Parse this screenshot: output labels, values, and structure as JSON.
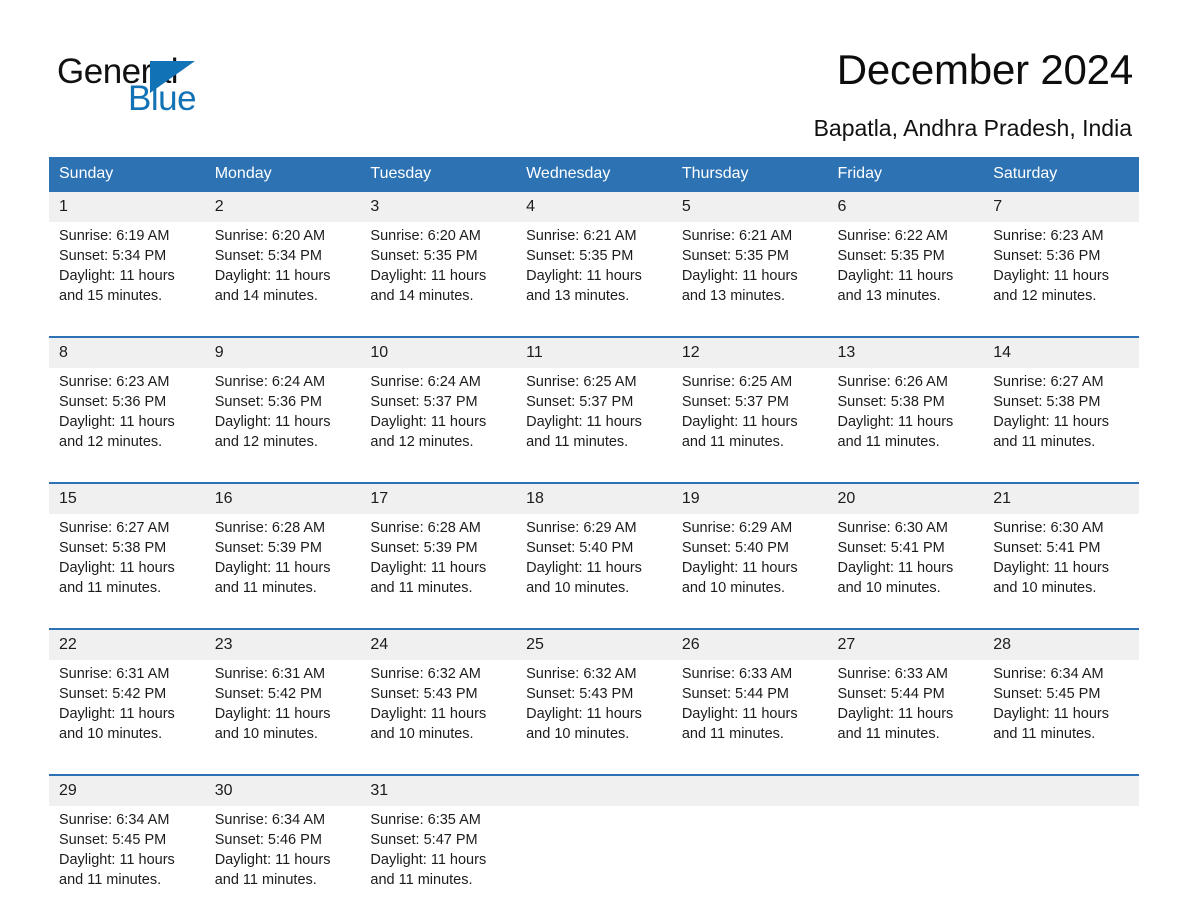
{
  "brand": {
    "name_part1": "General",
    "name_part2": "Blue",
    "triangle_color": "#1272b6"
  },
  "header": {
    "title": "December 2024",
    "location": "Bapatla, Andhra Pradesh, India"
  },
  "theme": {
    "header_blue": "#2d73b4",
    "daynum_background": "#f0f0f0",
    "text": "#1c1c1c"
  },
  "weekday_headers": [
    "Sunday",
    "Monday",
    "Tuesday",
    "Wednesday",
    "Thursday",
    "Friday",
    "Saturday"
  ],
  "weeks": [
    {
      "days": [
        {
          "date": "1",
          "sunrise": "Sunrise: 6:19 AM",
          "sunset": "Sunset: 5:34 PM",
          "daylight_line1": "Daylight: 11 hours",
          "daylight_line2": "and 15 minutes."
        },
        {
          "date": "2",
          "sunrise": "Sunrise: 6:20 AM",
          "sunset": "Sunset: 5:34 PM",
          "daylight_line1": "Daylight: 11 hours",
          "daylight_line2": "and 14 minutes."
        },
        {
          "date": "3",
          "sunrise": "Sunrise: 6:20 AM",
          "sunset": "Sunset: 5:35 PM",
          "daylight_line1": "Daylight: 11 hours",
          "daylight_line2": "and 14 minutes."
        },
        {
          "date": "4",
          "sunrise": "Sunrise: 6:21 AM",
          "sunset": "Sunset: 5:35 PM",
          "daylight_line1": "Daylight: 11 hours",
          "daylight_line2": "and 13 minutes."
        },
        {
          "date": "5",
          "sunrise": "Sunrise: 6:21 AM",
          "sunset": "Sunset: 5:35 PM",
          "daylight_line1": "Daylight: 11 hours",
          "daylight_line2": "and 13 minutes."
        },
        {
          "date": "6",
          "sunrise": "Sunrise: 6:22 AM",
          "sunset": "Sunset: 5:35 PM",
          "daylight_line1": "Daylight: 11 hours",
          "daylight_line2": "and 13 minutes."
        },
        {
          "date": "7",
          "sunrise": "Sunrise: 6:23 AM",
          "sunset": "Sunset: 5:36 PM",
          "daylight_line1": "Daylight: 11 hours",
          "daylight_line2": "and 12 minutes."
        }
      ]
    },
    {
      "days": [
        {
          "date": "8",
          "sunrise": "Sunrise: 6:23 AM",
          "sunset": "Sunset: 5:36 PM",
          "daylight_line1": "Daylight: 11 hours",
          "daylight_line2": "and 12 minutes."
        },
        {
          "date": "9",
          "sunrise": "Sunrise: 6:24 AM",
          "sunset": "Sunset: 5:36 PM",
          "daylight_line1": "Daylight: 11 hours",
          "daylight_line2": "and 12 minutes."
        },
        {
          "date": "10",
          "sunrise": "Sunrise: 6:24 AM",
          "sunset": "Sunset: 5:37 PM",
          "daylight_line1": "Daylight: 11 hours",
          "daylight_line2": "and 12 minutes."
        },
        {
          "date": "11",
          "sunrise": "Sunrise: 6:25 AM",
          "sunset": "Sunset: 5:37 PM",
          "daylight_line1": "Daylight: 11 hours",
          "daylight_line2": "and 11 minutes."
        },
        {
          "date": "12",
          "sunrise": "Sunrise: 6:25 AM",
          "sunset": "Sunset: 5:37 PM",
          "daylight_line1": "Daylight: 11 hours",
          "daylight_line2": "and 11 minutes."
        },
        {
          "date": "13",
          "sunrise": "Sunrise: 6:26 AM",
          "sunset": "Sunset: 5:38 PM",
          "daylight_line1": "Daylight: 11 hours",
          "daylight_line2": "and 11 minutes."
        },
        {
          "date": "14",
          "sunrise": "Sunrise: 6:27 AM",
          "sunset": "Sunset: 5:38 PM",
          "daylight_line1": "Daylight: 11 hours",
          "daylight_line2": "and 11 minutes."
        }
      ]
    },
    {
      "days": [
        {
          "date": "15",
          "sunrise": "Sunrise: 6:27 AM",
          "sunset": "Sunset: 5:38 PM",
          "daylight_line1": "Daylight: 11 hours",
          "daylight_line2": "and 11 minutes."
        },
        {
          "date": "16",
          "sunrise": "Sunrise: 6:28 AM",
          "sunset": "Sunset: 5:39 PM",
          "daylight_line1": "Daylight: 11 hours",
          "daylight_line2": "and 11 minutes."
        },
        {
          "date": "17",
          "sunrise": "Sunrise: 6:28 AM",
          "sunset": "Sunset: 5:39 PM",
          "daylight_line1": "Daylight: 11 hours",
          "daylight_line2": "and 11 minutes."
        },
        {
          "date": "18",
          "sunrise": "Sunrise: 6:29 AM",
          "sunset": "Sunset: 5:40 PM",
          "daylight_line1": "Daylight: 11 hours",
          "daylight_line2": "and 10 minutes."
        },
        {
          "date": "19",
          "sunrise": "Sunrise: 6:29 AM",
          "sunset": "Sunset: 5:40 PM",
          "daylight_line1": "Daylight: 11 hours",
          "daylight_line2": "and 10 minutes."
        },
        {
          "date": "20",
          "sunrise": "Sunrise: 6:30 AM",
          "sunset": "Sunset: 5:41 PM",
          "daylight_line1": "Daylight: 11 hours",
          "daylight_line2": "and 10 minutes."
        },
        {
          "date": "21",
          "sunrise": "Sunrise: 6:30 AM",
          "sunset": "Sunset: 5:41 PM",
          "daylight_line1": "Daylight: 11 hours",
          "daylight_line2": "and 10 minutes."
        }
      ]
    },
    {
      "days": [
        {
          "date": "22",
          "sunrise": "Sunrise: 6:31 AM",
          "sunset": "Sunset: 5:42 PM",
          "daylight_line1": "Daylight: 11 hours",
          "daylight_line2": "and 10 minutes."
        },
        {
          "date": "23",
          "sunrise": "Sunrise: 6:31 AM",
          "sunset": "Sunset: 5:42 PM",
          "daylight_line1": "Daylight: 11 hours",
          "daylight_line2": "and 10 minutes."
        },
        {
          "date": "24",
          "sunrise": "Sunrise: 6:32 AM",
          "sunset": "Sunset: 5:43 PM",
          "daylight_line1": "Daylight: 11 hours",
          "daylight_line2": "and 10 minutes."
        },
        {
          "date": "25",
          "sunrise": "Sunrise: 6:32 AM",
          "sunset": "Sunset: 5:43 PM",
          "daylight_line1": "Daylight: 11 hours",
          "daylight_line2": "and 10 minutes."
        },
        {
          "date": "26",
          "sunrise": "Sunrise: 6:33 AM",
          "sunset": "Sunset: 5:44 PM",
          "daylight_line1": "Daylight: 11 hours",
          "daylight_line2": "and 11 minutes."
        },
        {
          "date": "27",
          "sunrise": "Sunrise: 6:33 AM",
          "sunset": "Sunset: 5:44 PM",
          "daylight_line1": "Daylight: 11 hours",
          "daylight_line2": "and 11 minutes."
        },
        {
          "date": "28",
          "sunrise": "Sunrise: 6:34 AM",
          "sunset": "Sunset: 5:45 PM",
          "daylight_line1": "Daylight: 11 hours",
          "daylight_line2": "and 11 minutes."
        }
      ]
    },
    {
      "days": [
        {
          "date": "29",
          "sunrise": "Sunrise: 6:34 AM",
          "sunset": "Sunset: 5:45 PM",
          "daylight_line1": "Daylight: 11 hours",
          "daylight_line2": "and 11 minutes."
        },
        {
          "date": "30",
          "sunrise": "Sunrise: 6:34 AM",
          "sunset": "Sunset: 5:46 PM",
          "daylight_line1": "Daylight: 11 hours",
          "daylight_line2": "and 11 minutes."
        },
        {
          "date": "31",
          "sunrise": "Sunrise: 6:35 AM",
          "sunset": "Sunset: 5:47 PM",
          "daylight_line1": "Daylight: 11 hours",
          "daylight_line2": "and 11 minutes."
        },
        {
          "date": "",
          "sunrise": "",
          "sunset": "",
          "daylight_line1": "",
          "daylight_line2": ""
        },
        {
          "date": "",
          "sunrise": "",
          "sunset": "",
          "daylight_line1": "",
          "daylight_line2": ""
        },
        {
          "date": "",
          "sunrise": "",
          "sunset": "",
          "daylight_line1": "",
          "daylight_line2": ""
        },
        {
          "date": "",
          "sunrise": "",
          "sunset": "",
          "daylight_line1": "",
          "daylight_line2": ""
        }
      ]
    }
  ]
}
